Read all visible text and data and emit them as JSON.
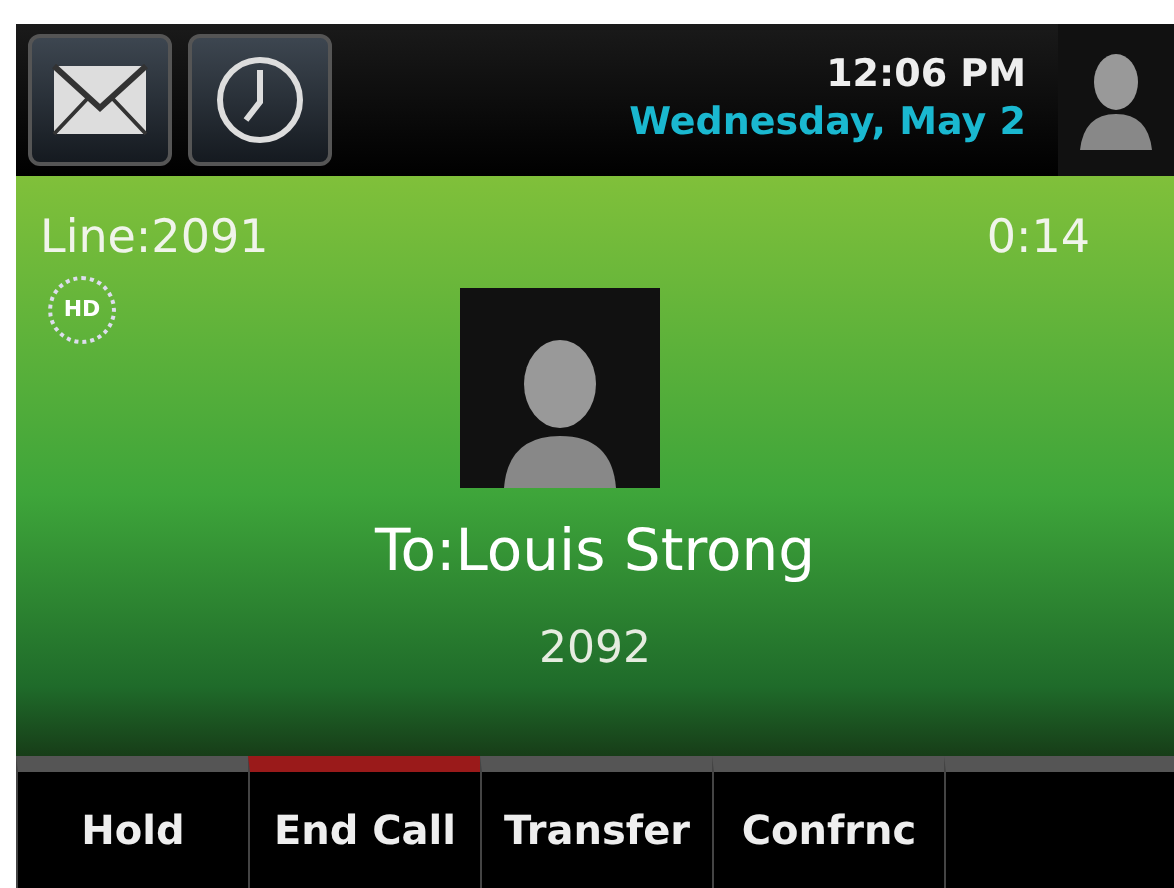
{
  "header": {
    "time": "12:06 PM",
    "date": "Wednesday, May 2"
  },
  "call": {
    "line": "Line:2091",
    "duration": "0:14",
    "hd_badge": "HD",
    "to": "To:Louis Strong",
    "number": "2092"
  },
  "softkeys": [
    {
      "label": "Hold",
      "kind": "normal"
    },
    {
      "label": "End Call",
      "kind": "end"
    },
    {
      "label": "Transfer",
      "kind": "normal"
    },
    {
      "label": "Confrnc",
      "kind": "normal"
    }
  ]
}
